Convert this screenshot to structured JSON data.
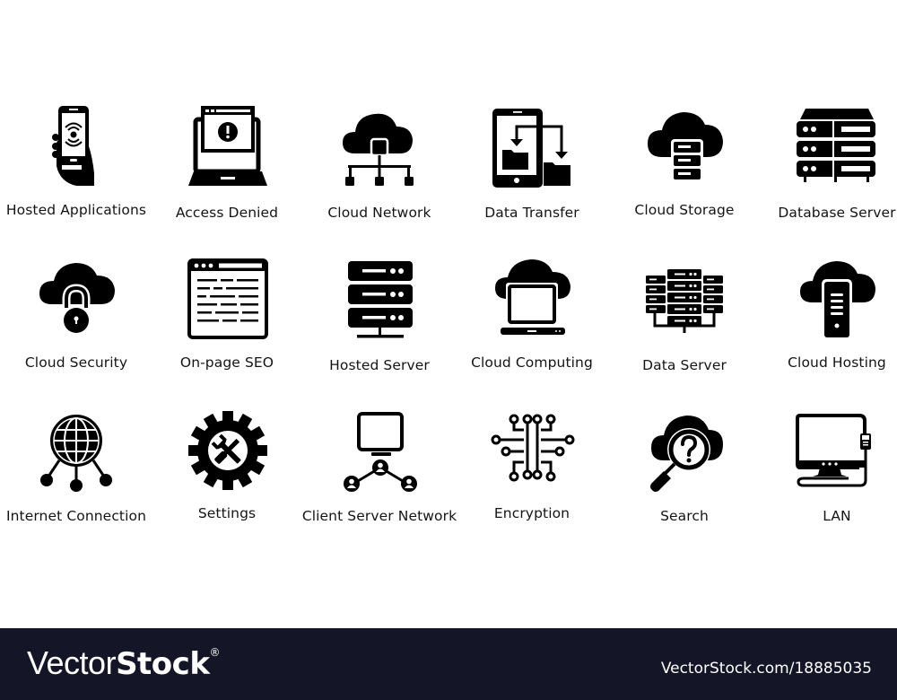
{
  "icons": [
    {
      "label": "Hosted Applications",
      "icon": "phone-in-hand-wireless-icon"
    },
    {
      "label": "Access Denied",
      "icon": "laptop-alert-icon"
    },
    {
      "label": "Cloud Network",
      "icon": "cloud-network-icon"
    },
    {
      "label": "Data Transfer",
      "icon": "phone-folder-transfer-icon"
    },
    {
      "label": "Cloud Storage",
      "icon": "cloud-storage-icon"
    },
    {
      "label": "Database Server",
      "icon": "database-server-icon"
    },
    {
      "label": "Cloud Security",
      "icon": "cloud-lock-icon"
    },
    {
      "label": "On-page SEO",
      "icon": "browser-text-icon"
    },
    {
      "label": "Hosted Server",
      "icon": "server-rack-icon"
    },
    {
      "label": "Cloud Computing",
      "icon": "cloud-laptop-icon"
    },
    {
      "label": "Data Server",
      "icon": "data-server-icon"
    },
    {
      "label": "Cloud Hosting",
      "icon": "cloud-tower-icon"
    },
    {
      "label": "Internet Connection",
      "icon": "globe-network-icon"
    },
    {
      "label": "Settings",
      "icon": "gear-tools-icon"
    },
    {
      "label": "Client Server Network",
      "icon": "client-server-icon"
    },
    {
      "label": "Encryption",
      "icon": "circuit-icon"
    },
    {
      "label": "Search",
      "icon": "cloud-search-question-icon"
    },
    {
      "label": "LAN",
      "icon": "monitor-lan-cable-icon"
    }
  ],
  "footer": {
    "brand_light": "Vector",
    "brand_bold": "Stock",
    "brand_mark": "®",
    "image_id_text": "VectorStock.com/18885035",
    "background": "#141526"
  }
}
